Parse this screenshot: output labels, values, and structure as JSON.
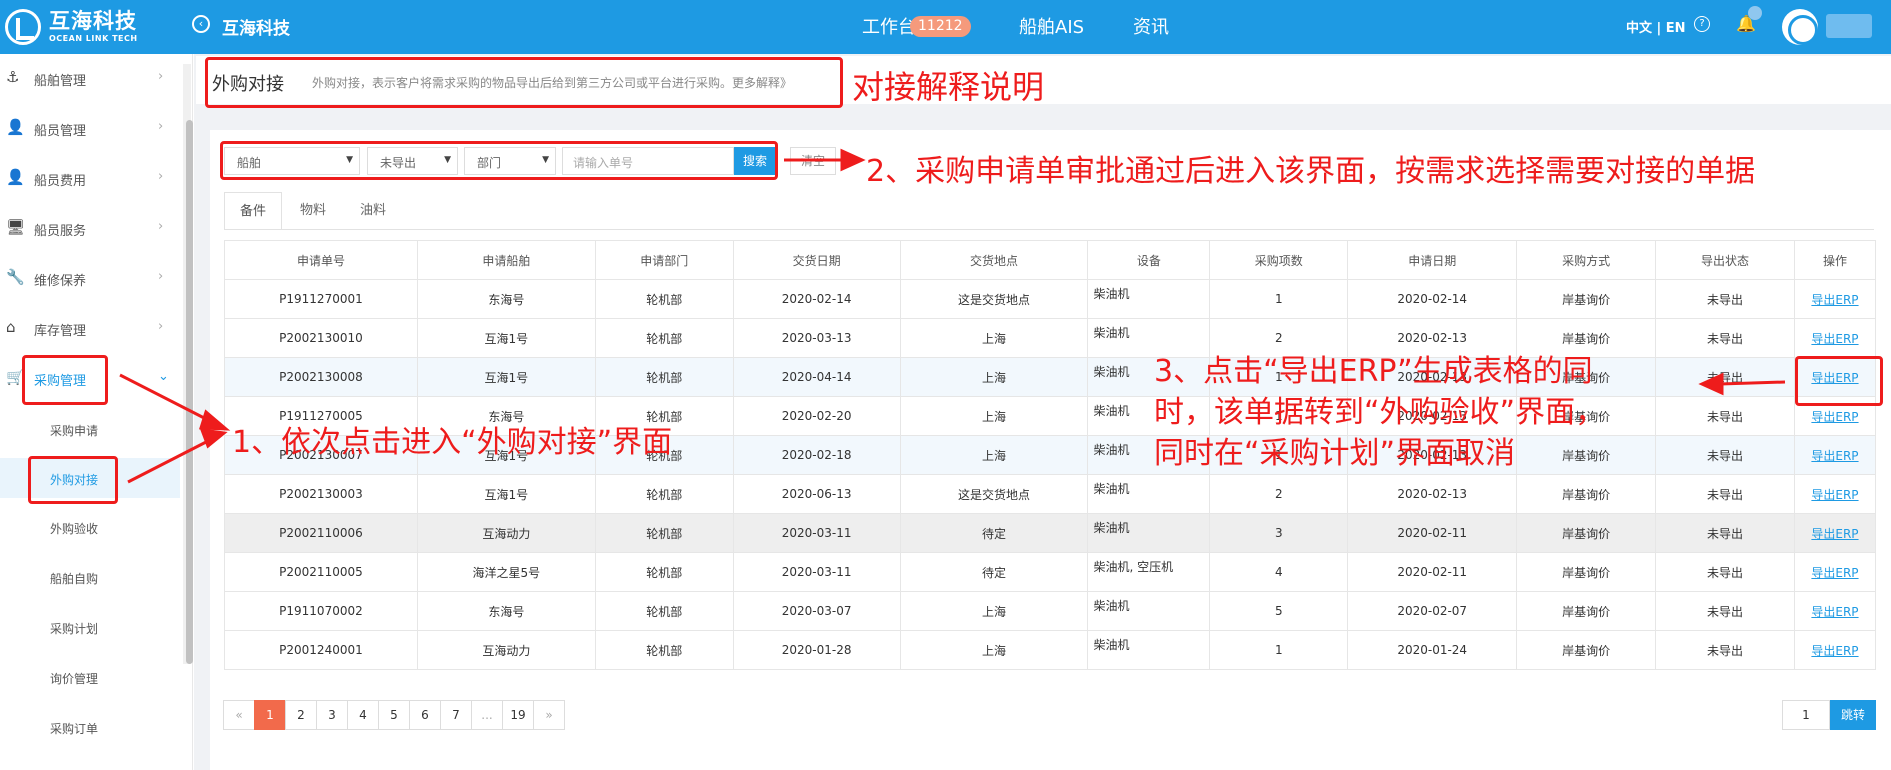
{
  "topbar": {
    "logo_cn": "互海科技",
    "logo_en": "OCEAN LINK TECH",
    "back_icon": "back-circle-icon",
    "brand": "互海科技",
    "nav": [
      {
        "label": "工作台"
      },
      {
        "label": "船舶AIS"
      },
      {
        "label": "资讯"
      }
    ],
    "badge_count": "11212",
    "lang": "中文 | EN",
    "help_glyph": "?",
    "bell_glyph": "🔔",
    "accent_color": "#1e9ae3"
  },
  "sidebar": {
    "items": [
      {
        "icon": "anchor-icon",
        "glyph": "⚓",
        "label": "船舶管理",
        "chev": "›"
      },
      {
        "icon": "user-icon",
        "glyph": "👤",
        "label": "船员管理",
        "chev": "›"
      },
      {
        "icon": "user-cost-icon",
        "glyph": "👤",
        "label": "船员费用",
        "chev": "›"
      },
      {
        "icon": "monitor-icon",
        "glyph": "🖥",
        "label": "船员服务",
        "chev": "›"
      },
      {
        "icon": "wrench-icon",
        "glyph": "🔧",
        "label": "维修保养",
        "chev": "›"
      },
      {
        "icon": "warehouse-icon",
        "glyph": "⌂",
        "label": "库存管理",
        "chev": "›"
      },
      {
        "icon": "cart-icon",
        "glyph": "🛒",
        "label": "采购管理",
        "chev": "⌄"
      }
    ],
    "sub_items": [
      {
        "label": "采购申请"
      },
      {
        "label": "外购对接"
      },
      {
        "label": "外购验收"
      },
      {
        "label": "船舶自购"
      },
      {
        "label": "采购计划"
      },
      {
        "label": "询价管理"
      },
      {
        "label": "采购订单"
      }
    ]
  },
  "header": {
    "title": "外购对接",
    "description": "外购对接，表示客户将需求采购的物品导出后给到第三方公司或平台进行采购。更多解释》"
  },
  "filters": {
    "ship": "船舶",
    "export_status": "未导出",
    "department": "部门",
    "order_placeholder": "请输入单号",
    "search_label": "搜索",
    "reset_label": "清空",
    "caret": "▼"
  },
  "tabs": [
    "备件",
    "物料",
    "油料"
  ],
  "table": {
    "columns": [
      "申请单号",
      "申请船舶",
      "申请部门",
      "交货日期",
      "交货地点",
      "设备",
      "采购项数",
      "申请日期",
      "采购方式",
      "导出状态",
      "操作"
    ],
    "rows": [
      [
        "P1911270001",
        "东海号",
        "轮机部",
        "2020-02-14",
        "这是交货地点",
        "柴油机",
        "1",
        "2020-02-14",
        "岸基询价",
        "未导出",
        "导出ERP"
      ],
      [
        "P2002130010",
        "互海1号",
        "轮机部",
        "2020-03-13",
        "上海",
        "柴油机",
        "2",
        "2020-02-13",
        "岸基询价",
        "未导出",
        "导出ERP"
      ],
      [
        "P2002130008",
        "互海1号",
        "轮机部",
        "2020-04-14",
        "上海",
        "柴油机",
        "1",
        "2020-02-13",
        "岸基询价",
        "未导出",
        "导出ERP"
      ],
      [
        "P1911270005",
        "东海号",
        "轮机部",
        "2020-02-20",
        "上海",
        "柴油机",
        "1",
        "2020-02-13",
        "岸基询价",
        "未导出",
        "导出ERP"
      ],
      [
        "P2002130007",
        "互海1号",
        "轮机部",
        "2020-02-18",
        "上海",
        "柴油机",
        "1",
        "2020-02-13",
        "岸基询价",
        "未导出",
        "导出ERP"
      ],
      [
        "P2002130003",
        "互海1号",
        "轮机部",
        "2020-06-13",
        "这是交货地点",
        "柴油机",
        "2",
        "2020-02-13",
        "岸基询价",
        "未导出",
        "导出ERP"
      ],
      [
        "P2002110006",
        "互海动力",
        "轮机部",
        "2020-03-11",
        "待定",
        "柴油机",
        "3",
        "2020-02-11",
        "岸基询价",
        "未导出",
        "导出ERP"
      ],
      [
        "P2002110005",
        "海洋之星5号",
        "轮机部",
        "2020-03-11",
        "待定",
        "柴油机, 空压机",
        "4",
        "2020-02-11",
        "岸基询价",
        "未导出",
        "导出ERP"
      ],
      [
        "P1911070002",
        "东海号",
        "轮机部",
        "2020-03-07",
        "上海",
        "柴油机",
        "5",
        "2020-02-07",
        "岸基询价",
        "未导出",
        "导出ERP"
      ],
      [
        "P2001240001",
        "互海动力",
        "轮机部",
        "2020-01-28",
        "上海",
        "柴油机",
        "1",
        "2020-01-24",
        "岸基询价",
        "未导出",
        "导出ERP"
      ]
    ]
  },
  "pagination": {
    "pages": [
      "«",
      "1",
      "2",
      "3",
      "4",
      "5",
      "6",
      "7",
      "...",
      "19",
      "»"
    ],
    "current": "1",
    "jump_value": "1",
    "jump_label": "跳转"
  },
  "annotations": {
    "header_note": "对接解释说明",
    "step1": "1、依次点击进入“外购对接”界面",
    "step2": "2、采购申请单审批通过后进入该界面，按需求选择需要对接的单据",
    "step3_line1": "3、点击“导出ERP”生成表格的同",
    "step3_line2": "时，该单据转到“外购验收”界面，",
    "step3_line3": "同时在“采购计划”界面取消",
    "color": "#ee1c1c"
  }
}
